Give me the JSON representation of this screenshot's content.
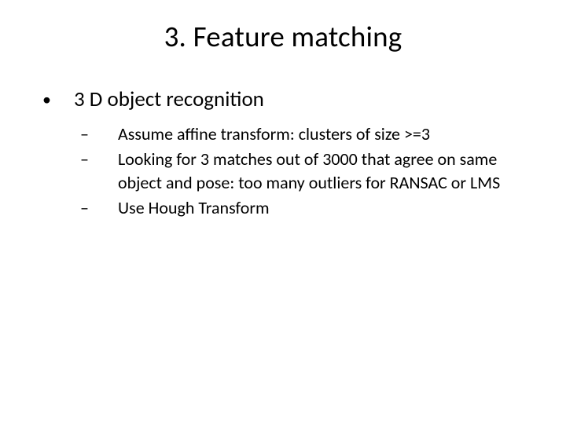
{
  "slide": {
    "title": "3. Feature matching",
    "bullets": [
      {
        "marker": "•",
        "text": "3 D object recognition",
        "children": [
          {
            "marker": "–",
            "text": "Assume affine transform: clusters of size >=3"
          },
          {
            "marker": "–",
            "text": "Looking for 3 matches out of 3000 that agree on same object and pose: too many outliers for RANSAC or LMS"
          },
          {
            "marker": "–",
            "text": "Use Hough Transform"
          }
        ]
      }
    ]
  }
}
